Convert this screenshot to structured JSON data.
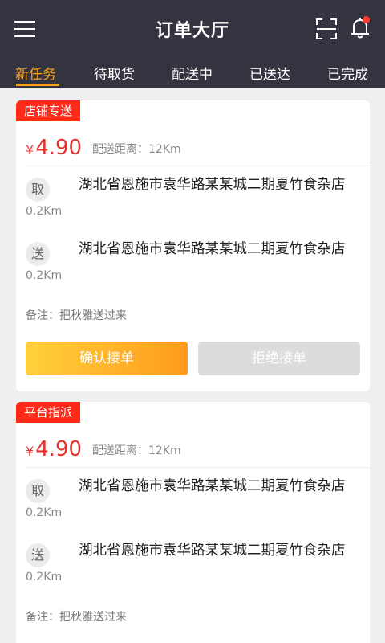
{
  "header": {
    "title": "订单大厅"
  },
  "tabs": [
    {
      "label": "新任务",
      "active": true
    },
    {
      "label": "待取货",
      "active": false
    },
    {
      "label": "配送中",
      "active": false
    },
    {
      "label": "已送达",
      "active": false
    },
    {
      "label": "已完成",
      "active": false
    }
  ],
  "orders": [
    {
      "tag": "店铺专送",
      "currency": "¥",
      "price": "4.90",
      "distance": "配送距离：12Km",
      "pickup": {
        "badge": "取",
        "distance": "0.2Km",
        "address": "湖北省恩施市袁华路某某城二期夏竹食杂店"
      },
      "delivery": {
        "badge": "送",
        "distance": "0.2Km",
        "address": "湖北省恩施市袁华路某某城二期夏竹食杂店"
      },
      "remark": "备注：把秋雅送过来",
      "accept_label": "确认接单",
      "reject_label": "拒绝接单"
    },
    {
      "tag": "平台指派",
      "currency": "¥",
      "price": "4.90",
      "distance": "配送距离：12Km",
      "pickup": {
        "badge": "取",
        "distance": "0.2Km",
        "address": "湖北省恩施市袁华路某某城二期夏竹食杂店"
      },
      "delivery": {
        "badge": "送",
        "distance": "0.2Km",
        "address": "湖北省恩施市袁华路某某城二期夏竹食杂店"
      },
      "remark": "备注：把秋雅送过来"
    }
  ],
  "colors": {
    "header_bg": "#33343f",
    "accent": "#ffa31a",
    "price": "#e8312a",
    "tag": "#ff2a1a"
  },
  "icons": {
    "menu": "menu-icon",
    "scan": "scan-icon",
    "bell": "bell-icon"
  }
}
